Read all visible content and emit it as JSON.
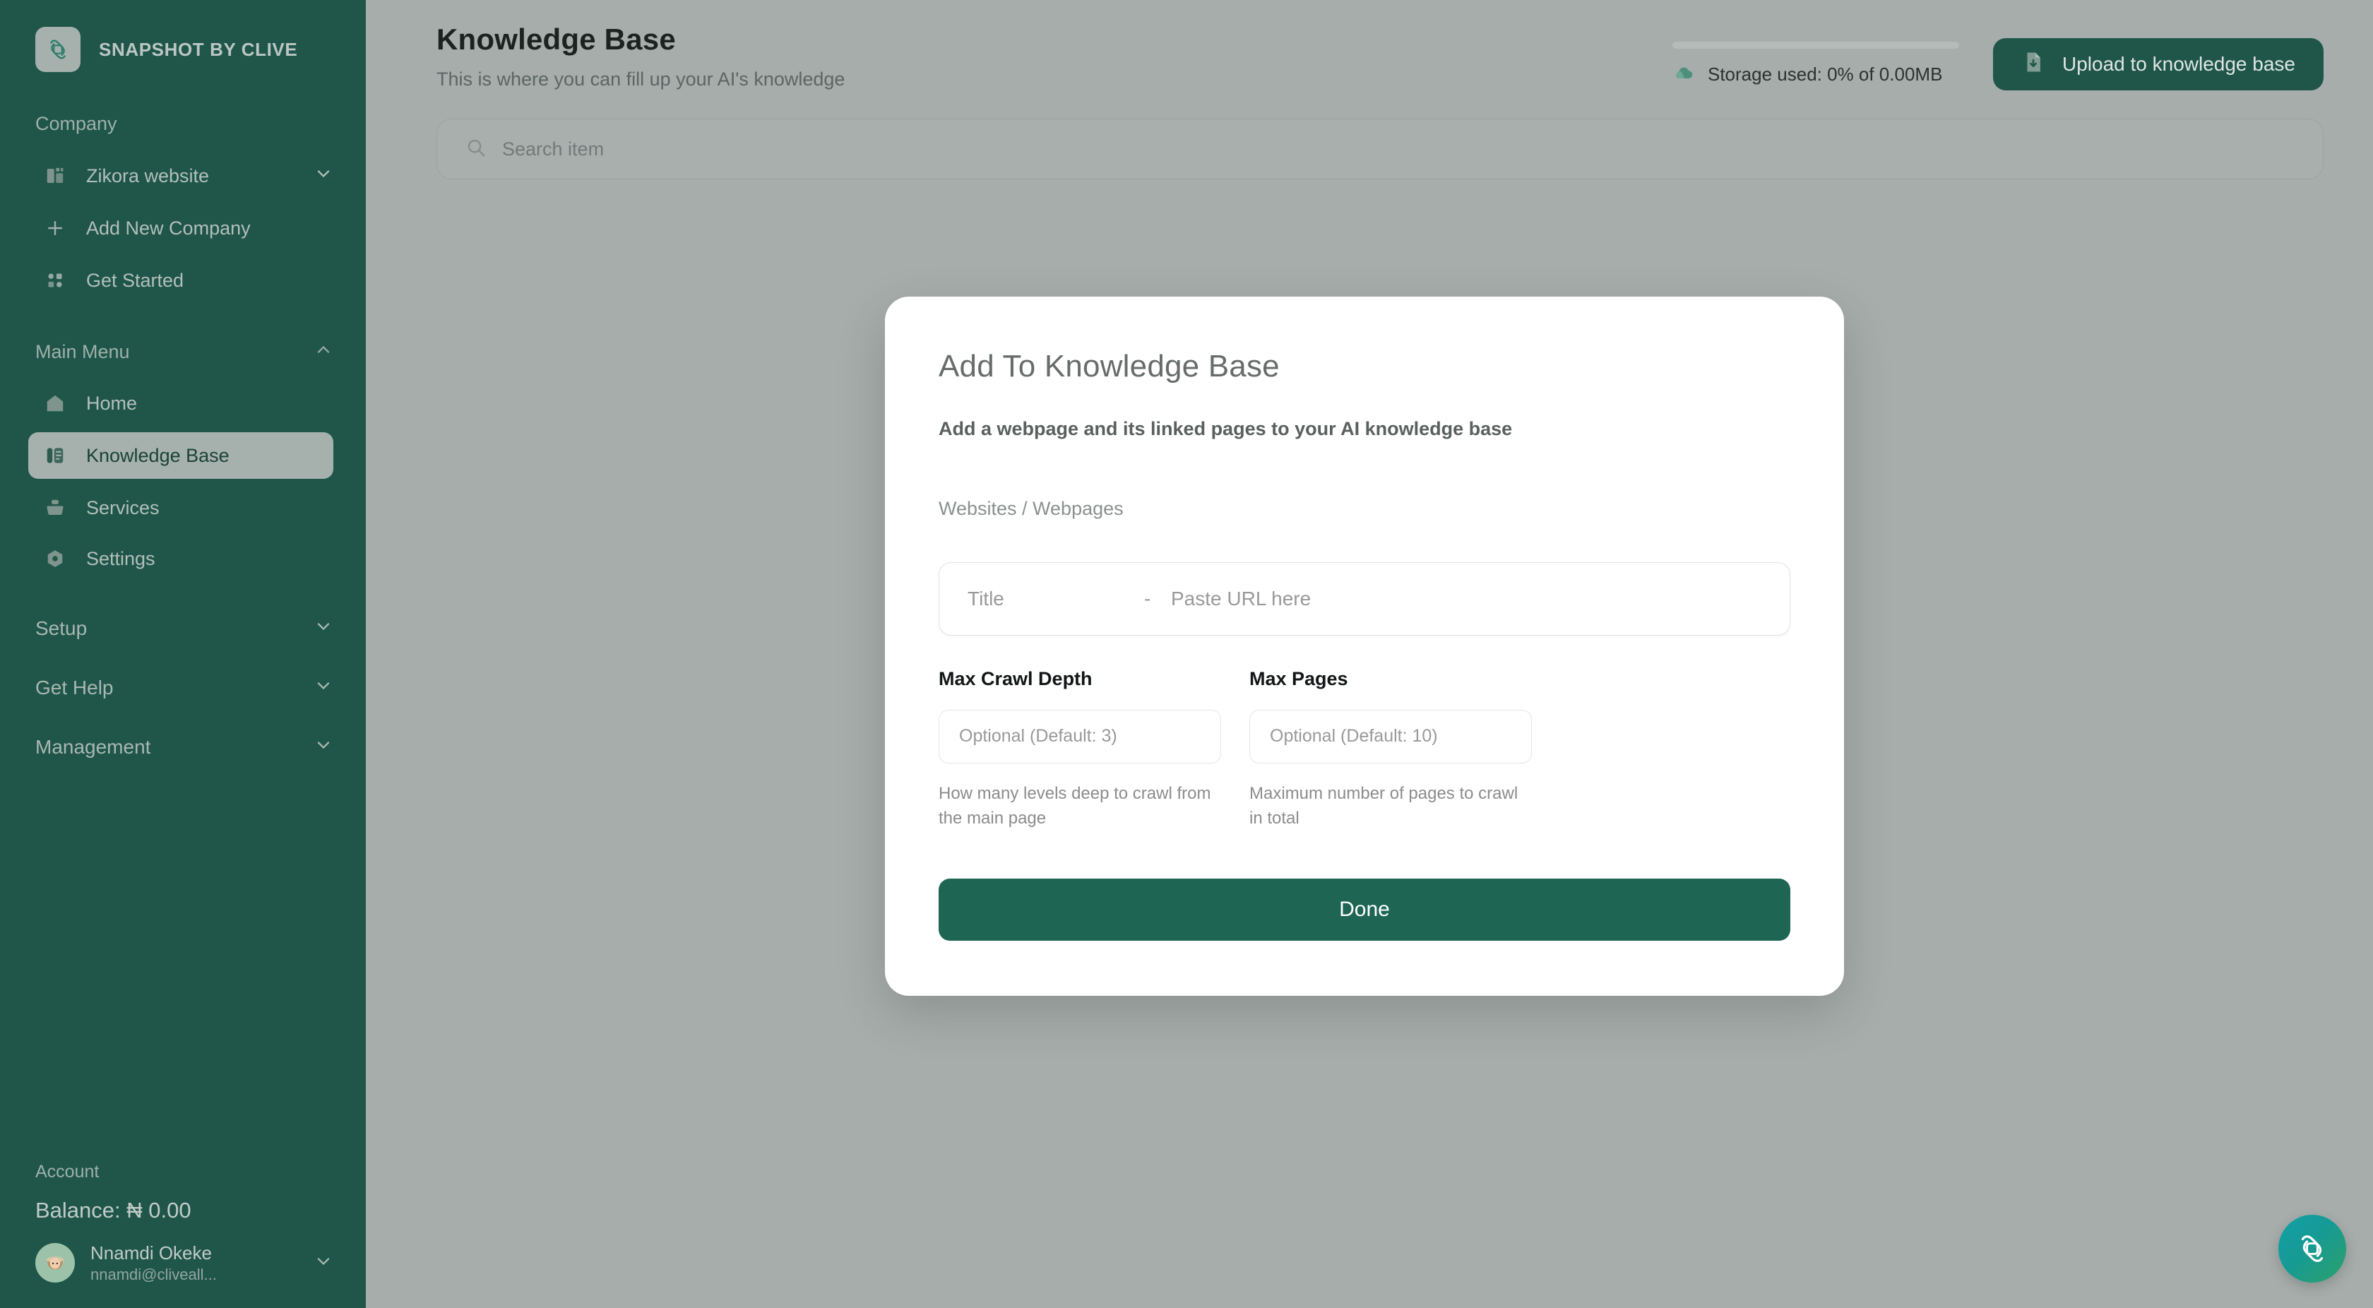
{
  "brand": {
    "name": "SNAPSHOT BY CLIVE",
    "logo_icon": "snapshot-logo-icon"
  },
  "sidebar": {
    "company_section": {
      "label": "Company",
      "items": [
        {
          "label": "Zikora website",
          "icon": "building-icon",
          "chevron": "chevron-down-icon"
        },
        {
          "label": "Add New Company",
          "icon": "plus-icon"
        },
        {
          "label": "Get Started",
          "icon": "grid-dots-icon"
        }
      ]
    },
    "main_menu": {
      "label": "Main Menu",
      "chevron": "chevron-up-icon",
      "items": [
        {
          "label": "Home",
          "icon": "home-icon",
          "active": false
        },
        {
          "label": "Knowledge Base",
          "icon": "knowledge-base-icon",
          "active": true
        },
        {
          "label": "Services",
          "icon": "services-icon",
          "active": false
        },
        {
          "label": "Settings",
          "icon": "settings-icon",
          "active": false
        }
      ]
    },
    "collapsibles": [
      {
        "label": "Setup",
        "chevron": "chevron-down-icon"
      },
      {
        "label": "Get Help",
        "chevron": "chevron-down-icon"
      },
      {
        "label": "Management",
        "chevron": "chevron-down-icon"
      }
    ],
    "account": {
      "label": "Account",
      "balance": "Balance: ₦ 0.00",
      "user_name": "Nnamdi Okeke",
      "user_email": "nnamdi@cliveall...",
      "chevron": "chevron-down-icon",
      "avatar_icon": "user-avatar"
    }
  },
  "header": {
    "title": "Knowledge Base",
    "subtitle": "This is where you can fill up your AI's knowledge",
    "storage_text": "Storage used: 0% of 0.00MB",
    "storage_percent": 0,
    "storage_icon": "cloud-storage-icon",
    "upload_label": "Upload to knowledge base",
    "upload_icon": "file-upload-icon"
  },
  "search": {
    "placeholder": "Search item",
    "icon": "search-icon"
  },
  "modal": {
    "title": "Add To Knowledge Base",
    "description": "Add a webpage and its linked pages to your AI knowledge base",
    "section_label": "Websites / Webpages",
    "title_placeholder": "Title",
    "separator": "-",
    "url_placeholder": "Paste URL here",
    "title_value": "",
    "url_value": "",
    "crawl_depth": {
      "label": "Max Crawl Depth",
      "placeholder": "Optional (Default: 3)",
      "value": "",
      "help": "How many levels deep to crawl from the main page"
    },
    "max_pages": {
      "label": "Max Pages",
      "placeholder": "Optional (Default: 10)",
      "value": "",
      "help": "Maximum number of pages to crawl in total"
    },
    "done_label": "Done"
  },
  "fab": {
    "icon": "snapshot-assistant-icon"
  },
  "colors": {
    "sidebar_bg": "#1f5649",
    "accent_green": "#1f6554",
    "overlay_bg": "#a6adab",
    "active_item_bg": "#a6b1ae",
    "modal_bg": "#ffffff"
  }
}
